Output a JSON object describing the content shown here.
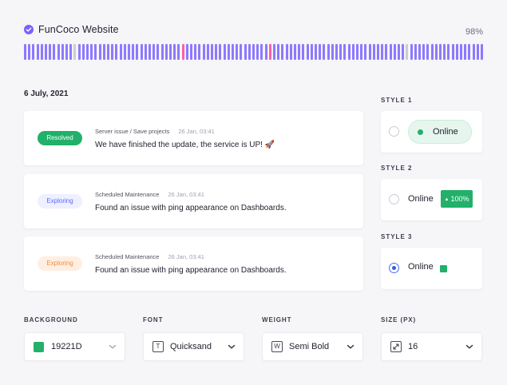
{
  "header": {
    "title": "FunCoco Website",
    "uptime": "98%"
  },
  "uptime_bars": [
    "up",
    "up",
    "up",
    "up",
    "up",
    "up",
    "up",
    "up",
    "up",
    "up",
    "up",
    "up",
    "gap",
    "up",
    "up",
    "up",
    "up",
    "up",
    "up",
    "up",
    "up",
    "up",
    "up",
    "up",
    "up",
    "up",
    "up",
    "up",
    "up",
    "up",
    "up",
    "up",
    "up",
    "up",
    "up",
    "up",
    "up",
    "up",
    "down",
    "up",
    "up",
    "up",
    "up",
    "up",
    "up",
    "up",
    "up",
    "up",
    "up",
    "up",
    "up",
    "up",
    "up",
    "up",
    "up",
    "up",
    "up",
    "up",
    "up",
    "down",
    "up",
    "up",
    "up",
    "up",
    "up",
    "up",
    "up",
    "up",
    "up",
    "up",
    "up",
    "up",
    "up",
    "up",
    "up",
    "up",
    "up",
    "up",
    "up",
    "up",
    "up",
    "up",
    "up",
    "up",
    "up",
    "up",
    "up",
    "up",
    "up",
    "up",
    "up",
    "up",
    "gap",
    "up",
    "up",
    "up",
    "up",
    "up",
    "up",
    "up",
    "up",
    "up",
    "up",
    "up",
    "up",
    "up",
    "up",
    "up",
    "up",
    "up",
    "up"
  ],
  "date": "6 July, 2021",
  "incidents": [
    {
      "status": "Resolved",
      "category": "Server issue / Save projects",
      "time": "26 Jan, 03:41",
      "message": "We have finished the update, the service is UP! 🚀"
    },
    {
      "status": "Exploring",
      "category": "Scheduled Maintenance",
      "time": "26 Jan, 03:41",
      "message": "Found an issue with ping appearance on Dashboards."
    },
    {
      "status": "Exploring",
      "category": "Scheduled Maintenance",
      "time": "26 Jan, 03:41",
      "message": "Found an issue with ping appearance on Dashboards."
    }
  ],
  "styles": [
    {
      "label": "STYLE 1",
      "text": "Online",
      "selected": false
    },
    {
      "label": "STYLE 2",
      "text": "Online",
      "badge": "100%",
      "selected": false
    },
    {
      "label": "STYLE 3",
      "text": "Online",
      "selected": true
    }
  ],
  "controls": {
    "background": {
      "label": "BACKGROUND",
      "value": "19221D",
      "swatch_color": "#22b06a"
    },
    "font": {
      "label": "FONT",
      "value": "Quicksand",
      "icon": "T"
    },
    "weight": {
      "label": "WEIGHT",
      "value": "Semi Bold",
      "icon": "W"
    },
    "size": {
      "label": "SIZE (PX)",
      "value": "16",
      "icon": "resize-icon"
    }
  },
  "colors": {
    "accent": "#7b61ff",
    "up": "#8d79ff",
    "down": "#ff5ea8",
    "green": "#22b06a"
  }
}
